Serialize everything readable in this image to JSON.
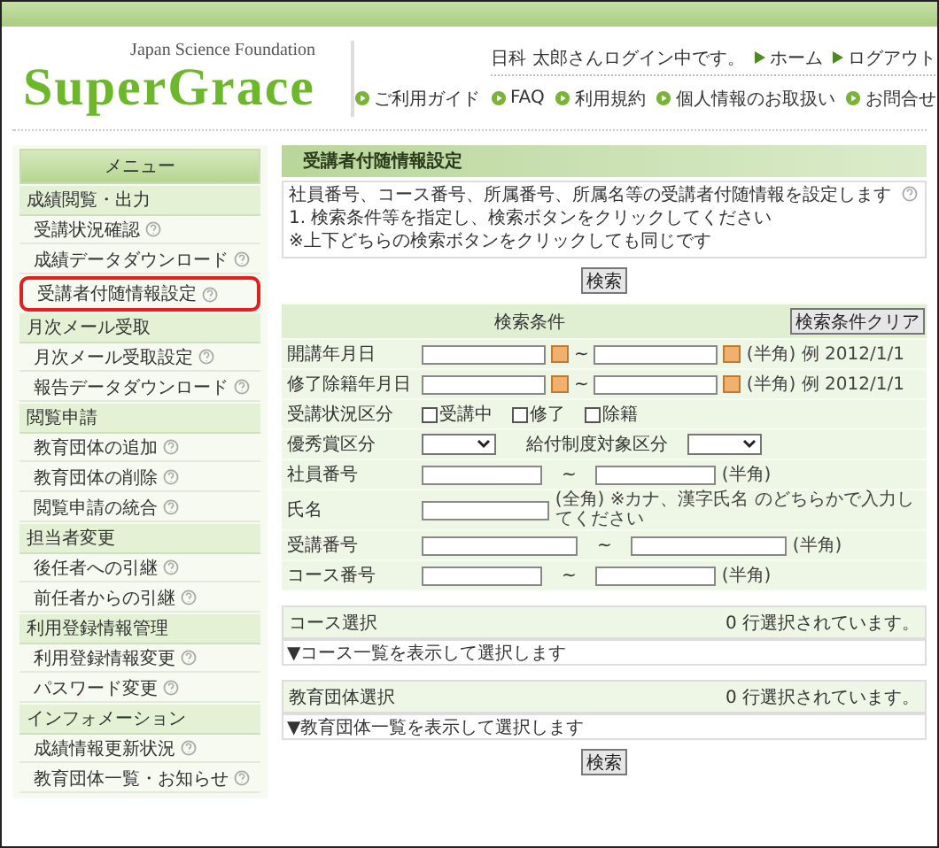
{
  "header": {
    "org": "Japan Science Foundation",
    "logo": "SuperGrace",
    "user": "日科 太郎さんログイン中です。",
    "top_links": [
      "ホーム",
      "ログアウト"
    ],
    "nav_links": [
      "ご利用ガイド",
      "FAQ",
      "利用規約",
      "個人情報のお取扱い",
      "お問合せ"
    ]
  },
  "sidebar": {
    "title": "メニュー",
    "groups": [
      {
        "label": "成績閲覧・出力",
        "items": [
          {
            "label": "受講状況確認",
            "selected": false
          },
          {
            "label": "成績データダウンロード",
            "selected": false
          },
          {
            "label": "受講者付随情報設定",
            "selected": true
          }
        ]
      },
      {
        "label": "月次メール受取",
        "items": [
          {
            "label": "月次メール受取設定",
            "selected": false
          },
          {
            "label": "報告データダウンロード",
            "selected": false
          }
        ]
      },
      {
        "label": "閲覧申請",
        "items": [
          {
            "label": "教育団体の追加",
            "selected": false
          },
          {
            "label": "教育団体の削除",
            "selected": false
          },
          {
            "label": "閲覧申請の統合",
            "selected": false
          }
        ]
      },
      {
        "label": "担当者変更",
        "items": [
          {
            "label": "後任者への引継",
            "selected": false
          },
          {
            "label": "前任者からの引継",
            "selected": false
          }
        ]
      },
      {
        "label": "利用登録情報管理",
        "items": [
          {
            "label": "利用登録情報変更",
            "selected": false
          },
          {
            "label": "パスワード変更",
            "selected": false
          }
        ]
      },
      {
        "label": "インフォメーション",
        "items": [
          {
            "label": "成績情報更新状況",
            "selected": false
          },
          {
            "label": "教育団体一覧・お知らせ",
            "selected": false
          }
        ]
      }
    ]
  },
  "main": {
    "title": "受講者付随情報設定",
    "description": [
      "社員番号、コース番号、所属番号、所属名等の受講者付随情報を設定します",
      "1. 検索条件等を指定し、検索ボタンをクリックしてください",
      "※上下どちらの検索ボタンをクリックしても同じです"
    ],
    "search_button": "検索",
    "form": {
      "header": "検索条件",
      "clear_button": "検索条件クリア",
      "rows": [
        {
          "kind": "date_range",
          "label": "開講年月日",
          "sep": "~",
          "note": "(半角) 例 2012/1/1"
        },
        {
          "kind": "date_range",
          "label": "修了除籍年月日",
          "sep": "~",
          "note": "(半角) 例 2012/1/1"
        },
        {
          "kind": "checks",
          "label": "受講状況区分",
          "options": [
            {
              "label": "受講中",
              "checked": false
            },
            {
              "label": "修了",
              "checked": false
            },
            {
              "label": "除籍",
              "checked": false
            }
          ]
        },
        {
          "kind": "selects",
          "label": "優秀賞区分",
          "label2": "給付制度対象区分"
        },
        {
          "kind": "range",
          "label": "社員番号",
          "sep": "~",
          "note": "(半角)",
          "wide": false
        },
        {
          "kind": "text",
          "label": "氏名",
          "note": "(全角) ※カナ、漢字氏名 のどちらかで入力してください"
        },
        {
          "kind": "range",
          "label": "受講番号",
          "sep": "~",
          "note": "(半角)",
          "wide": true
        },
        {
          "kind": "range",
          "label": "コース番号",
          "sep": "~",
          "note": "(半角)",
          "wide": false
        }
      ]
    },
    "sections": [
      {
        "label": "コース選択",
        "count": "0 行選択されています。",
        "link": "▼コース一覧を表示して選択します"
      },
      {
        "label": "教育団体選択",
        "count": "0 行選択されています。",
        "link": "▼教育団体一覧を表示して選択します"
      }
    ],
    "bottom_button": "検索"
  }
}
